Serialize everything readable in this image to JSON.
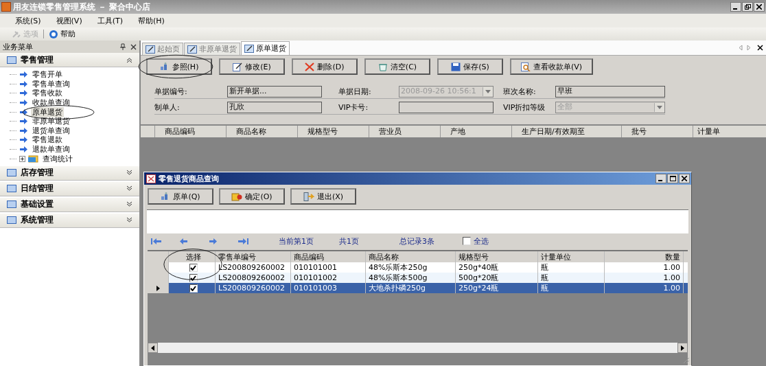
{
  "window": {
    "title": "用友连锁零售管理系统 － 聚合中心店"
  },
  "menu": [
    "系统(S)",
    "视图(V)",
    "工具(T)",
    "帮助(H)"
  ],
  "toolbar": [
    {
      "label": "选项",
      "disabled": true
    },
    {
      "label": "帮助",
      "disabled": false
    }
  ],
  "sidebar": {
    "title": "业务菜单",
    "groups": [
      {
        "label": "零售管理",
        "expanded": true,
        "children": [
          {
            "label": "零售开单",
            "kind": "link",
            "selected": false,
            "circled": false
          },
          {
            "label": "零售单查询",
            "kind": "link",
            "selected": false,
            "circled": false
          },
          {
            "label": "零售收款",
            "kind": "link",
            "selected": false,
            "circled": false
          },
          {
            "label": "收款单查询",
            "kind": "link",
            "selected": false,
            "circled": false
          },
          {
            "label": "原单退货",
            "kind": "link",
            "selected": true,
            "circled": true
          },
          {
            "label": "非原单退货",
            "kind": "link",
            "selected": false,
            "circled": false
          },
          {
            "label": "退货单查询",
            "kind": "link",
            "selected": false,
            "circled": false
          },
          {
            "label": "零售退款",
            "kind": "link",
            "selected": false,
            "circled": false
          },
          {
            "label": "退款单查询",
            "kind": "link",
            "selected": false,
            "circled": false
          },
          {
            "label": "查询统计",
            "kind": "folder",
            "selected": false,
            "circled": false
          }
        ]
      },
      {
        "label": "店存管理",
        "expanded": false
      },
      {
        "label": "日结管理",
        "expanded": false
      },
      {
        "label": "基础设置",
        "expanded": false
      },
      {
        "label": "系统管理",
        "expanded": false
      }
    ]
  },
  "tabs": [
    {
      "label": "起始页",
      "selected": false
    },
    {
      "label": "非原单退货",
      "selected": false
    },
    {
      "label": "原单退货",
      "selected": true
    }
  ],
  "actions": [
    {
      "label": "参照(H)",
      "kind": "refer",
      "circled": true
    },
    {
      "label": "修改(E)",
      "kind": "edit",
      "circled": false
    },
    {
      "label": "删除(D)",
      "kind": "delete",
      "circled": false
    },
    {
      "label": "清空(C)",
      "kind": "clear",
      "circled": false
    },
    {
      "label": "保存(S)",
      "kind": "save",
      "circled": false
    },
    {
      "label": "查看收款单(V)",
      "kind": "view",
      "circled": false
    }
  ],
  "form": [
    [
      {
        "label": "单据编号:",
        "value": "新开单据...",
        "disabled": false,
        "dropdown": false
      },
      {
        "label": "单据日期:",
        "value": "2008-09-26 10:56:1",
        "disabled": true,
        "dropdown": true
      },
      {
        "label": "班次名称:",
        "value": "早班",
        "disabled": false,
        "dropdown": false
      }
    ],
    [
      {
        "label": "制单人:",
        "value": "孔欣",
        "disabled": false,
        "dropdown": false
      },
      {
        "label": "VIP卡号:",
        "disabled": false,
        "dropdown": false
      },
      {
        "label": "VIP折扣等级",
        "value": "全部",
        "disabled": true,
        "dropdown": true
      }
    ]
  ],
  "grid": {
    "columns": [
      "商品编码",
      "商品名称",
      "规格型号",
      "营业员",
      "产地",
      "生产日期/有效期至",
      "批号",
      "计量单"
    ]
  },
  "dialog": {
    "title": "零售退货商品查询",
    "buttons": [
      {
        "label": "原单(Q)",
        "kind": "refer"
      },
      {
        "label": "确定(O)",
        "kind": "confirm"
      },
      {
        "label": "退出(X)",
        "kind": "exit"
      }
    ],
    "pager": {
      "current": "当前第1页",
      "total": "共1页",
      "records": "总记录3条"
    },
    "select_all": {
      "label": "全选",
      "checked": false
    },
    "check_column": {
      "label": "选择",
      "circled": true
    },
    "columns": [
      "零售单编号",
      "商品编码",
      "商品名称",
      "规格型号",
      "计量单位",
      "数量"
    ],
    "rows": [
      {
        "checked": true,
        "selected": false,
        "cells": [
          "LS200809260002",
          "010101001",
          "48%乐斯本250g",
          "250g*40瓶",
          "瓶",
          "1.00"
        ]
      },
      {
        "checked": true,
        "selected": false,
        "cells": [
          "LS200809260002",
          "010101002",
          "48%乐斯本500g",
          "500g*20瓶",
          "瓶",
          "1.00"
        ]
      },
      {
        "checked": true,
        "selected": true,
        "cells": [
          "LS200809260002",
          "010101003",
          "大地杀扑磷250g",
          "250g*24瓶",
          "瓶",
          "1.00"
        ]
      }
    ]
  }
}
